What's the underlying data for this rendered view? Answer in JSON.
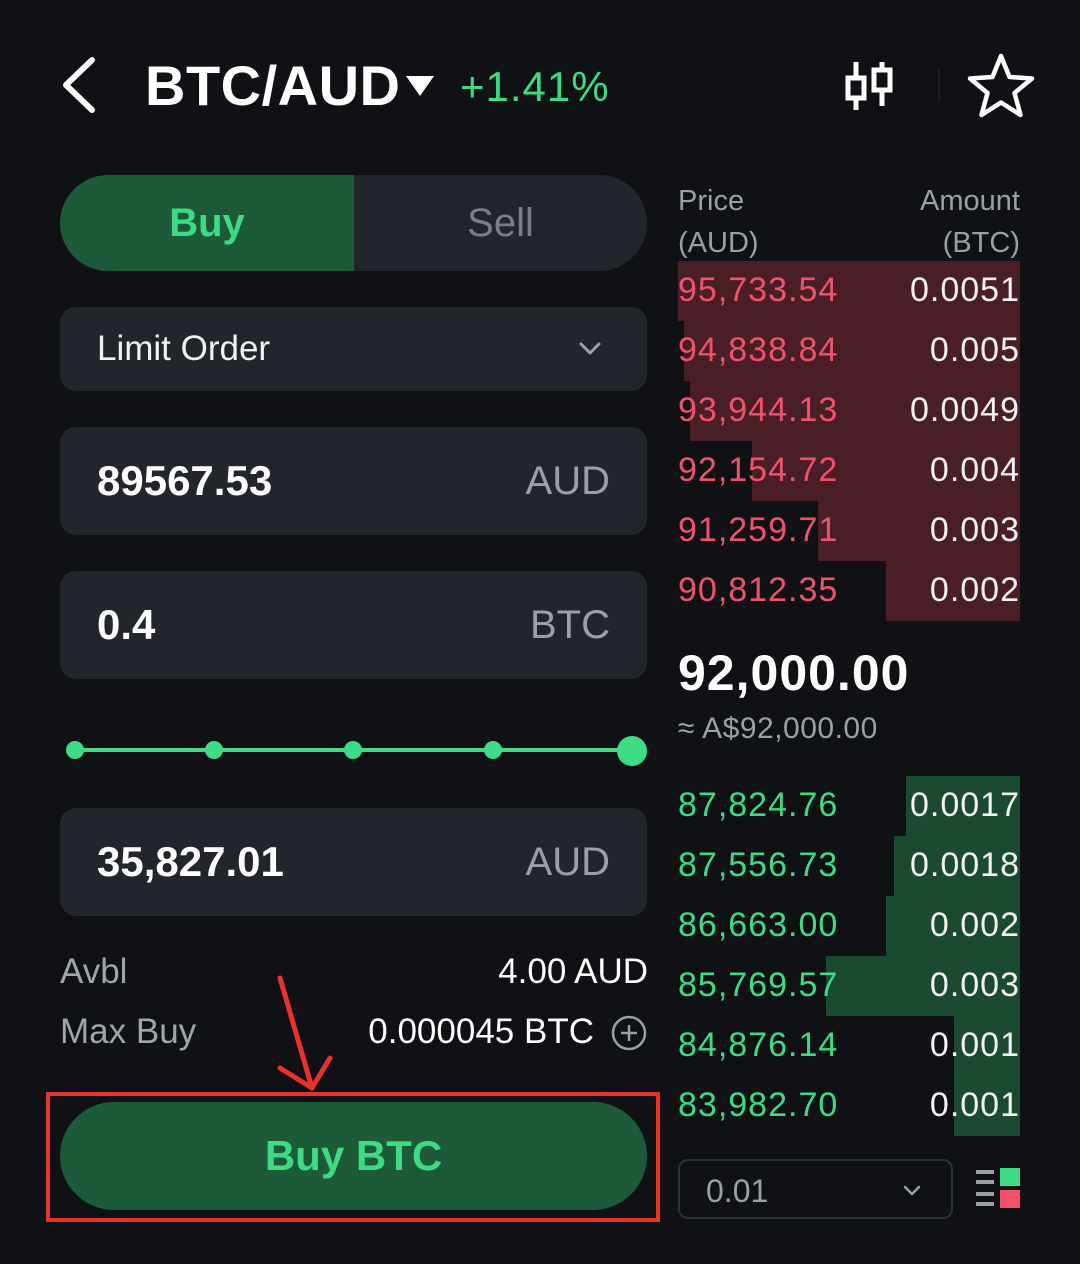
{
  "header": {
    "pair": "BTC/AUD",
    "change": "+1.41%"
  },
  "trade": {
    "tabs": {
      "buy": "Buy",
      "sell": "Sell"
    },
    "order_type": "Limit Order",
    "price": {
      "value": "89567.53",
      "unit": "AUD"
    },
    "amount": {
      "value": "0.4",
      "unit": "BTC"
    },
    "slider_percent": 100,
    "total": {
      "value": "35,827.01",
      "unit": "AUD"
    },
    "avbl": {
      "label": "Avbl",
      "value": "4.00 AUD"
    },
    "max_buy": {
      "label": "Max Buy",
      "value": "0.000045 BTC"
    },
    "submit_label": "Buy BTC"
  },
  "order_book": {
    "headers": {
      "price": "Price",
      "price_unit": "(AUD)",
      "amount": "Amount",
      "amount_unit": "(BTC)"
    },
    "asks": [
      {
        "price": "95,733.54",
        "amount": "0.0051"
      },
      {
        "price": "94,838.84",
        "amount": "0.005"
      },
      {
        "price": "93,944.13",
        "amount": "0.0049"
      },
      {
        "price": "92,154.72",
        "amount": "0.004"
      },
      {
        "price": "91,259.71",
        "amount": "0.003"
      },
      {
        "price": "90,812.35",
        "amount": "0.002"
      }
    ],
    "mid_price": "92,000.00",
    "mid_price_fiat": "≈ A$92,000.00",
    "bids": [
      {
        "price": "87,824.76",
        "amount": "0.0017"
      },
      {
        "price": "87,556.73",
        "amount": "0.0018"
      },
      {
        "price": "86,663.00",
        "amount": "0.002"
      },
      {
        "price": "85,769.57",
        "amount": "0.003"
      },
      {
        "price": "84,876.14",
        "amount": "0.001"
      },
      {
        "price": "83,982.70",
        "amount": "0.001"
      }
    ],
    "precision": "0.01"
  },
  "colors": {
    "accent_green": "#3ddc84",
    "ask_red": "#f0526b",
    "highlight": "#e8332a"
  }
}
